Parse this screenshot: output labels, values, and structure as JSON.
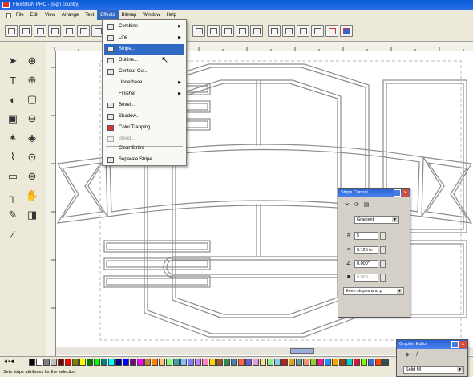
{
  "window": {
    "title": "FlexiSIGN PRO - [sign country]"
  },
  "menubar": {
    "items": [
      "File",
      "Edit",
      "View",
      "Arrange",
      "Text",
      "Effects",
      "Bitmap",
      "Window",
      "Help"
    ]
  },
  "effects_menu": {
    "items": [
      {
        "label": "Combine",
        "submenu": true
      },
      {
        "label": "Line",
        "submenu": true
      },
      {
        "label": "Stripe...",
        "selected": true
      },
      {
        "label": "Outline..."
      },
      {
        "label": "Contour Cut..."
      },
      {
        "label": "Underbase",
        "submenu": true
      },
      {
        "label": "Finisher",
        "submenu": true
      },
      {
        "label": "Bevel..."
      },
      {
        "label": "Shadow..."
      },
      {
        "label": "Color Trapping..."
      },
      {
        "label": "Blend...",
        "disabled": true
      },
      {
        "label": "Clear Stripe"
      },
      {
        "label": "Separate Stripe"
      }
    ]
  },
  "stripe_panel": {
    "title": "Stripe Control",
    "fill_type": "Gradient",
    "count": "5",
    "width": "0.125 in",
    "offset": "0.000\"",
    "spacing": "0.000",
    "mode": "Even stripes and p"
  },
  "graphic_panel": {
    "title": "Graphic Editor",
    "fill": "Solid fill"
  },
  "palette": {
    "colors": [
      "#000000",
      "#ffffff",
      "#808080",
      "#c0c0c0",
      "#800000",
      "#ff0000",
      "#808000",
      "#ffff00",
      "#008000",
      "#00ff00",
      "#008080",
      "#00ffff",
      "#000080",
      "#0000ff",
      "#800080",
      "#ff00ff",
      "#c08040",
      "#ff8000",
      "#ffc080",
      "#80ff80",
      "#40a0a0",
      "#80c0ff",
      "#8080ff",
      "#c080ff",
      "#ff80c0",
      "#ffd700",
      "#a0522d",
      "#2e8b57",
      "#4682b4",
      "#ff6347",
      "#6a5acd",
      "#dda0dd",
      "#f0e68c",
      "#90ee90",
      "#87ceeb",
      "#b22222",
      "#daa520",
      "#5f9ea0",
      "#e9967a",
      "#9acd32",
      "#ff1493",
      "#1e90ff",
      "#ffa500",
      "#8b4513",
      "#00ced1",
      "#dc143c",
      "#7fff00",
      "#4169e1",
      "#ff4500",
      "#2f4f4f"
    ]
  },
  "statusbar": {
    "text": "Sets stripe attributes for the selection"
  },
  "accent": "#316ac5"
}
